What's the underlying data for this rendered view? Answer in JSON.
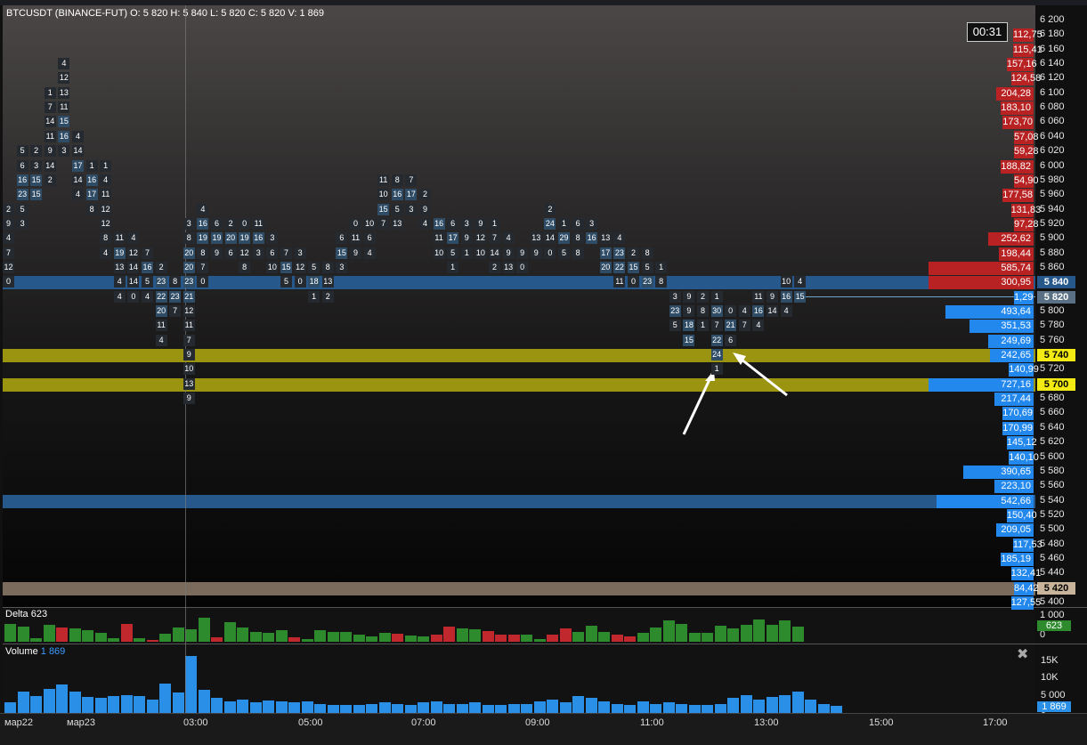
{
  "symbol_info": "BTCUSDT (BINANCE-FUT)  O: 5 820   H: 5 840   L: 5 820   C: 5 820   V: 1 869",
  "countdown": "00:31",
  "colors": {
    "ask": "#b82222",
    "bid": "#2288ee",
    "poc": "#26588c",
    "level": "#9a9410",
    "low": "#7b6b5c",
    "delta_pos": "#2d8a2d",
    "delta_neg": "#c0282e",
    "volume": "#2a8fe6"
  },
  "price_ticks": [
    "6 200",
    "6 180",
    "6 160",
    "6 140",
    "6 120",
    "6 100",
    "6 080",
    "6 060",
    "6 040",
    "6 020",
    "6 000",
    "5 980",
    "5 960",
    "5 940",
    "5 920",
    "5 900",
    "5 880",
    "5 860",
    "5 840",
    "5 820",
    "5 800",
    "5 780",
    "5 760",
    "5 740",
    "5 720",
    "5 700",
    "5 680",
    "5 660",
    "5 640",
    "5 620",
    "5 600",
    "5 580",
    "5 560",
    "5 540",
    "5 520",
    "5 500",
    "5 480",
    "5 460",
    "5 440",
    "5 420",
    "5 400"
  ],
  "band_labels": {
    "current": "5 840",
    "last": "5 820",
    "level1": "5 740",
    "level2": "5 700",
    "low": "5 420"
  },
  "volume_profile": [
    {
      "price": "6 180",
      "value": "112,75",
      "side": "ask",
      "level": 0.1
    },
    {
      "price": "6 160",
      "value": "115,41",
      "side": "ask",
      "level": 0.1
    },
    {
      "price": "6 140",
      "value": "157,16",
      "side": "ask",
      "level": 0.13
    },
    {
      "price": "6 120",
      "value": "124,58",
      "side": "ask",
      "level": 0.11
    },
    {
      "price": "6 100",
      "value": "204,28",
      "side": "ask",
      "level": 0.18
    },
    {
      "price": "6 080",
      "value": "183,10",
      "side": "ask",
      "level": 0.16
    },
    {
      "price": "6 060",
      "value": "173,70",
      "side": "ask",
      "level": 0.15
    },
    {
      "price": "6 040",
      "value": "57,08",
      "side": "ask",
      "level": 0.05
    },
    {
      "price": "6 020",
      "value": "59,28",
      "side": "ask",
      "level": 0.05
    },
    {
      "price": "6 000",
      "value": "188,82",
      "side": "ask",
      "level": 0.16
    },
    {
      "price": "5 980",
      "value": "54,90",
      "side": "ask",
      "level": 0.05
    },
    {
      "price": "5 960",
      "value": "177,58",
      "side": "ask",
      "level": 0.15
    },
    {
      "price": "5 940",
      "value": "131,83",
      "side": "ask",
      "level": 0.11
    },
    {
      "price": "5 920",
      "value": "97,28",
      "side": "ask",
      "level": 0.08
    },
    {
      "price": "5 900",
      "value": "252,62",
      "side": "ask",
      "level": 0.22
    },
    {
      "price": "5 880",
      "value": "198,44",
      "side": "ask",
      "level": 0.17
    },
    {
      "price": "5 860",
      "value": "585,74",
      "side": "ask",
      "level": 0.51
    },
    {
      "price": "5 840",
      "value": "300,95",
      "side": "ask",
      "level": 0.51
    },
    {
      "price": "5 820",
      "value": "1,29",
      "side": "bid",
      "level": 0.02
    },
    {
      "price": "5 800",
      "value": "493,64",
      "side": "bid",
      "level": 0.43
    },
    {
      "price": "5 780",
      "value": "351,53",
      "side": "bid",
      "level": 0.31
    },
    {
      "price": "5 760",
      "value": "249,69",
      "side": "bid",
      "level": 0.22
    },
    {
      "price": "5 740",
      "value": "242,65",
      "side": "bid",
      "level": 0.21
    },
    {
      "price": "5 720",
      "value": "140,99",
      "side": "bid",
      "level": 0.12
    },
    {
      "price": "5 700",
      "value": "727,16",
      "side": "bid",
      "level": 0.51
    },
    {
      "price": "5 680",
      "value": "217,44",
      "side": "bid",
      "level": 0.19
    },
    {
      "price": "5 660",
      "value": "170,69",
      "side": "bid",
      "level": 0.15
    },
    {
      "price": "5 640",
      "value": "170,99",
      "side": "bid",
      "level": 0.15
    },
    {
      "price": "5 620",
      "value": "145,12",
      "side": "bid",
      "level": 0.13
    },
    {
      "price": "5 600",
      "value": "140,10",
      "side": "bid",
      "level": 0.12
    },
    {
      "price": "5 580",
      "value": "390,65",
      "side": "bid",
      "level": 0.34
    },
    {
      "price": "5 560",
      "value": "223,10",
      "side": "bid",
      "level": 0.19
    },
    {
      "price": "5 540",
      "value": "542,66",
      "side": "bid",
      "level": 0.47
    },
    {
      "price": "5 520",
      "value": "150,40",
      "side": "bid",
      "level": 0.13
    },
    {
      "price": "5 500",
      "value": "209,05",
      "side": "bid",
      "level": 0.18
    },
    {
      "price": "5 480",
      "value": "117,53",
      "side": "bid",
      "level": 0.1
    },
    {
      "price": "5 460",
      "value": "185,19",
      "side": "bid",
      "level": 0.16
    },
    {
      "price": "5 440",
      "value": "132,41",
      "side": "bid",
      "level": 0.11
    },
    {
      "price": "5 420",
      "value": "84,42",
      "side": "bid",
      "level": 0.07
    },
    {
      "price": "5 400",
      "value": "127,55",
      "side": "bid",
      "level": 0.11
    }
  ],
  "footprint": [
    {
      "col": 0,
      "price_top": "5 940",
      "values": [
        2,
        9,
        4,
        7,
        12,
        0
      ]
    },
    {
      "col": 1,
      "price_top": "6 020",
      "values": [
        5,
        6,
        16,
        23,
        5,
        3
      ]
    },
    {
      "col": 2,
      "price_top": "6 020",
      "values": [
        2,
        3,
        15,
        15
      ]
    },
    {
      "col": 3,
      "price_top": "6 100",
      "values": [
        1,
        7,
        14,
        11,
        9,
        14,
        2
      ]
    },
    {
      "col": 4,
      "price_top": "6 140",
      "values": [
        4,
        12,
        13,
        11,
        15,
        16,
        3
      ]
    },
    {
      "col": 5,
      "price_top": "6 040",
      "values": [
        4,
        14,
        17,
        14,
        4
      ]
    },
    {
      "col": 6,
      "price_top": "6 000",
      "values": [
        1,
        16,
        17,
        8
      ]
    },
    {
      "col": 7,
      "price_top": "6 000",
      "values": [
        1,
        4,
        11,
        12,
        12,
        8,
        4
      ]
    },
    {
      "col": 8,
      "price_top": "5 900",
      "values": [
        11,
        19,
        13,
        4,
        4
      ]
    },
    {
      "col": 9,
      "price_top": "5 900",
      "values": [
        4,
        12,
        14,
        14,
        0
      ]
    },
    {
      "col": 10,
      "price_top": "5 880",
      "values": [
        7,
        16,
        5,
        4
      ]
    },
    {
      "col": 11,
      "price_top": "5 860",
      "values": [
        2,
        23,
        22,
        20,
        11,
        4
      ]
    },
    {
      "col": 12,
      "price_top": "5 840",
      "values": [
        8,
        23,
        7
      ]
    },
    {
      "col": 13,
      "price_top": "5 920",
      "values": [
        3,
        8,
        20,
        20,
        23,
        21,
        12,
        11,
        7,
        9,
        10,
        13,
        9
      ]
    },
    {
      "col": 14,
      "price_top": "5 940",
      "values": [
        4,
        16,
        19,
        8,
        7,
        0
      ]
    },
    {
      "col": 15,
      "price_top": "5 920",
      "values": [
        6,
        19,
        9
      ]
    },
    {
      "col": 16,
      "price_top": "5 920",
      "values": [
        2,
        20,
        6
      ]
    },
    {
      "col": 17,
      "price_top": "5 920",
      "values": [
        0,
        19,
        12,
        8
      ]
    },
    {
      "col": 18,
      "price_top": "5 920",
      "values": [
        11,
        16,
        3
      ]
    },
    {
      "col": 19,
      "price_top": "5 900",
      "values": [
        3,
        6,
        10
      ]
    },
    {
      "col": 20,
      "price_top": "5 880",
      "values": [
        7,
        15,
        5
      ]
    },
    {
      "col": 21,
      "price_top": "5 880",
      "values": [
        3,
        12,
        0
      ]
    },
    {
      "col": 22,
      "price_top": "5 860",
      "values": [
        5,
        18,
        1
      ]
    },
    {
      "col": 23,
      "price_top": "5 860",
      "values": [
        8,
        13,
        2
      ]
    },
    {
      "col": 24,
      "price_top": "5 900",
      "values": [
        6,
        15,
        3
      ]
    },
    {
      "col": 25,
      "price_top": "5 920",
      "values": [
        0,
        11,
        9
      ]
    },
    {
      "col": 26,
      "price_top": "5 920",
      "values": [
        10,
        6,
        4
      ]
    },
    {
      "col": 27,
      "price_top": "5 980",
      "values": [
        11,
        10,
        15,
        7
      ]
    },
    {
      "col": 28,
      "price_top": "5 980",
      "values": [
        8,
        16,
        5,
        13
      ]
    },
    {
      "col": 29,
      "price_top": "5 980",
      "values": [
        7,
        17,
        3
      ]
    },
    {
      "col": 30,
      "price_top": "5 960",
      "values": [
        2,
        9,
        4
      ]
    },
    {
      "col": 31,
      "price_top": "5 920",
      "values": [
        16,
        11,
        10
      ]
    },
    {
      "col": 32,
      "price_top": "5 920",
      "values": [
        6,
        17,
        5,
        1
      ]
    },
    {
      "col": 33,
      "price_top": "5 920",
      "values": [
        3,
        9,
        1
      ]
    },
    {
      "col": 34,
      "price_top": "5 920",
      "values": [
        9,
        12,
        10
      ]
    },
    {
      "col": 35,
      "price_top": "5 920",
      "values": [
        1,
        7,
        14,
        2
      ]
    },
    {
      "col": 36,
      "price_top": "5 900",
      "values": [
        4,
        9,
        13
      ]
    },
    {
      "col": 37,
      "price_top": "5 880",
      "values": [
        9,
        0
      ]
    },
    {
      "col": 38,
      "price_top": "5 900",
      "values": [
        13,
        9
      ]
    },
    {
      "col": 39,
      "price_top": "5 940",
      "values": [
        2,
        24,
        14,
        0
      ]
    },
    {
      "col": 40,
      "price_top": "5 920",
      "values": [
        1,
        29,
        5
      ]
    },
    {
      "col": 41,
      "price_top": "5 920",
      "values": [
        6,
        8,
        8
      ]
    },
    {
      "col": 42,
      "price_top": "5 920",
      "values": [
        3,
        16
      ]
    },
    {
      "col": 43,
      "price_top": "5 900",
      "values": [
        13,
        17,
        20
      ]
    },
    {
      "col": 44,
      "price_top": "5 900",
      "values": [
        4,
        23,
        22,
        11
      ]
    },
    {
      "col": 45,
      "price_top": "5 880",
      "values": [
        2,
        15,
        0
      ]
    },
    {
      "col": 46,
      "price_top": "5 880",
      "values": [
        8,
        5,
        23
      ]
    },
    {
      "col": 47,
      "price_top": "5 860",
      "values": [
        1,
        8
      ]
    },
    {
      "col": 48,
      "price_top": "5 820",
      "values": [
        3,
        23,
        5
      ]
    },
    {
      "col": 49,
      "price_top": "5 820",
      "values": [
        9,
        9,
        18,
        15
      ]
    },
    {
      "col": 50,
      "price_top": "5 820",
      "values": [
        2,
        8,
        1
      ]
    },
    {
      "col": 51,
      "price_top": "5 820",
      "values": [
        1,
        30,
        7,
        22,
        24,
        1
      ]
    },
    {
      "col": 52,
      "price_top": "5 800",
      "values": [
        0,
        21,
        6
      ]
    },
    {
      "col": 53,
      "price_top": "5 800",
      "values": [
        4,
        7
      ]
    },
    {
      "col": 54,
      "price_top": "5 820",
      "values": [
        11,
        16,
        4
      ]
    },
    {
      "col": 55,
      "price_top": "5 820",
      "values": [
        9,
        14
      ]
    },
    {
      "col": 56,
      "price_top": "5 840",
      "values": [
        10,
        16,
        4
      ]
    },
    {
      "col": 57,
      "price_top": "5 840",
      "values": [
        4,
        15
      ]
    }
  ],
  "delta": {
    "title": "Delta",
    "value": "623",
    "axis": [
      "1 000",
      "0"
    ],
    "bars": [
      62,
      54,
      14,
      58,
      49,
      46,
      41,
      32,
      13,
      62,
      13,
      7,
      27,
      51,
      44,
      84,
      17,
      70,
      49,
      35,
      32,
      40,
      17,
      10,
      40,
      34,
      33,
      25,
      20,
      32,
      28,
      23,
      20,
      24,
      52,
      48,
      43,
      36,
      24,
      24,
      24,
      10,
      26,
      48,
      35,
      55,
      35,
      26,
      20,
      30,
      50,
      75,
      62,
      30,
      30,
      55,
      46,
      60,
      77,
      60,
      75,
      52
    ],
    "signs": [
      1,
      1,
      1,
      1,
      -1,
      1,
      1,
      1,
      1,
      -1,
      1,
      -1,
      1,
      1,
      1,
      1,
      -1,
      1,
      1,
      1,
      1,
      1,
      -1,
      1,
      1,
      1,
      1,
      1,
      1,
      1,
      -1,
      1,
      1,
      -1,
      -1,
      1,
      1,
      -1,
      -1,
      -1,
      1,
      1,
      -1,
      -1,
      1,
      1,
      1,
      -1,
      -1,
      1,
      1,
      1,
      1,
      1,
      1,
      1,
      1,
      1,
      1,
      1,
      1,
      1
    ]
  },
  "volume": {
    "title": "Volume",
    "value": "1 869",
    "axis": [
      "15K",
      "10K",
      "5 000",
      "0"
    ],
    "bars": [
      18,
      38,
      30,
      42,
      50,
      38,
      28,
      26,
      30,
      32,
      30,
      24,
      52,
      36,
      100,
      40,
      26,
      20,
      24,
      18,
      22,
      20,
      18,
      20,
      16,
      14,
      14,
      14,
      16,
      18,
      16,
      14,
      18,
      20,
      16,
      16,
      18,
      14,
      14,
      16,
      16,
      20,
      24,
      18,
      30,
      26,
      20,
      16,
      14,
      20,
      16,
      18,
      16,
      14,
      14,
      16,
      26,
      32,
      24,
      28,
      32,
      38,
      24,
      16,
      12
    ]
  },
  "time_labels": [
    "мар22",
    "мар23",
    "03:00",
    "05:00",
    "07:00",
    "09:00",
    "11:00",
    "13:00",
    "15:00",
    "17:00"
  ]
}
